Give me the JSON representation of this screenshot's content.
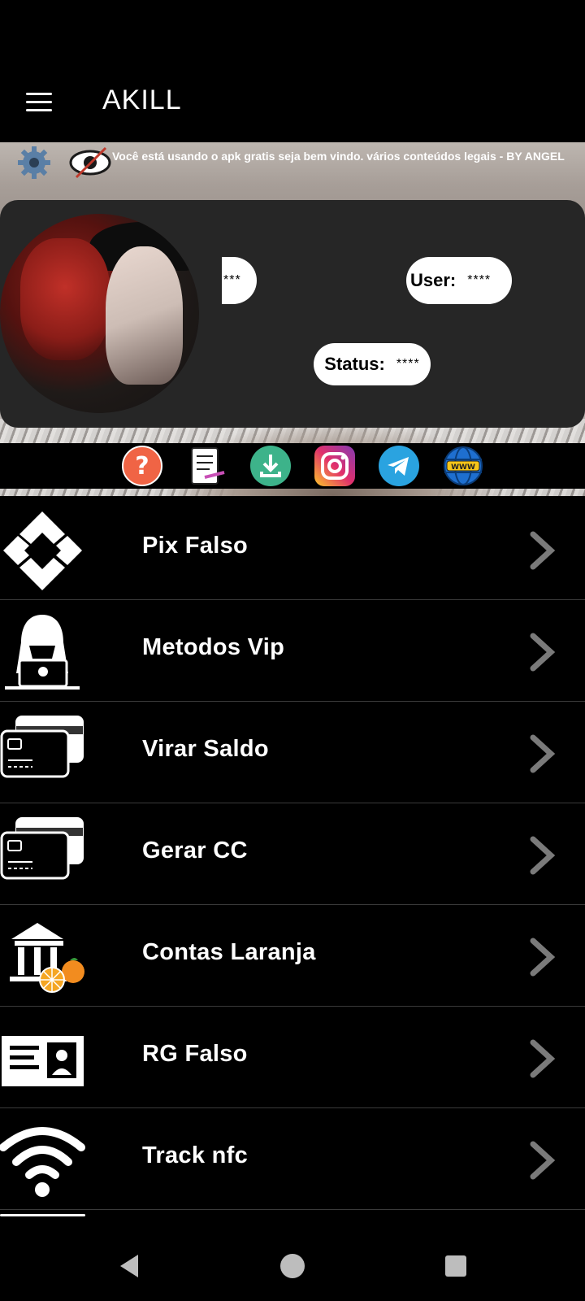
{
  "app_bar": {
    "title": "AKILL",
    "menu_icon": "hamburger-menu-icon"
  },
  "banner": {
    "notice": "Você está usando o apk gratis seja bem vindo. vários conteúdos legais  - BY ANGEL",
    "settings_icon": "gear-icon",
    "visibility_icon": "eye-off-icon"
  },
  "profile": {
    "hidden_value": "***",
    "user_label": "User:",
    "user_value": "****",
    "status_label": "Status:",
    "status_value": "****"
  },
  "quick_icons": [
    {
      "name": "help-icon",
      "color": "#f06445"
    },
    {
      "name": "document-icon",
      "color": "#ffffff"
    },
    {
      "name": "download-icon",
      "color": "#3db38a"
    },
    {
      "name": "instagram-icon",
      "color": "#d6249f"
    },
    {
      "name": "telegram-icon",
      "color": "#2aa3e0"
    },
    {
      "name": "www-globe-icon",
      "color": "#1e6fd0"
    }
  ],
  "menu": {
    "items": [
      {
        "label": "Pix Falso",
        "icon": "pix-icon"
      },
      {
        "label": "Metodos Vip",
        "icon": "hacker-icon"
      },
      {
        "label": "Virar Saldo",
        "icon": "cards-icon"
      },
      {
        "label": "Gerar CC",
        "icon": "cards-icon"
      },
      {
        "label": "Contas Laranja",
        "icon": "bank-orange-icon"
      },
      {
        "label": "RG Falso",
        "icon": "id-card-icon"
      },
      {
        "label": "Track nfc",
        "icon": "wifi-icon"
      }
    ],
    "chevron_icon": "chevron-right-icon"
  },
  "colors": {
    "background": "#000000",
    "card": "#262626",
    "accent_orange": "#f28c1f"
  },
  "nav": {
    "back_icon": "back-triangle-icon",
    "home_icon": "home-circle-icon",
    "recents_icon": "recents-square-icon"
  }
}
